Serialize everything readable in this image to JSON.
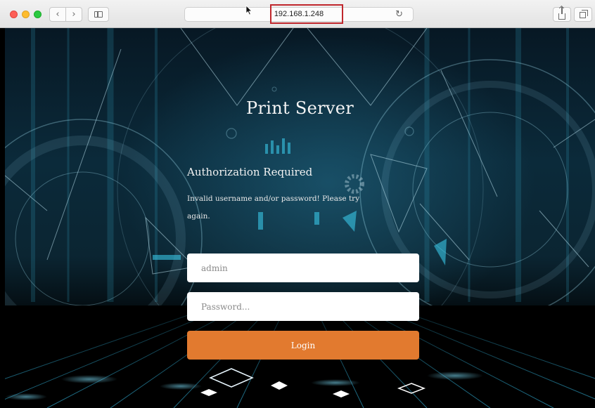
{
  "browser": {
    "url": "192.168.1.248",
    "back_glyph": "‹",
    "forward_glyph": "›",
    "reload_glyph": "↻",
    "icons": [
      "close-dot",
      "minimize-dot",
      "zoom-dot",
      "back-chevron-icon",
      "forward-chevron-icon",
      "sidebar-icon",
      "reload-icon",
      "share-icon",
      "tabs-icon",
      "mouse-cursor-icon"
    ],
    "highlight_color": "#c0272d"
  },
  "page": {
    "title": "Print Server",
    "auth_heading": "Authorization Required",
    "auth_message": "Invalid username and/or password! Please try again.",
    "username": {
      "value": "",
      "placeholder": "admin"
    },
    "password": {
      "value": "",
      "placeholder": "Password..."
    },
    "login_label": "Login"
  },
  "colors": {
    "login_button": "#e27a2f",
    "background_teal": "#0b2a3a",
    "grid_line": "#3ad0ff"
  }
}
